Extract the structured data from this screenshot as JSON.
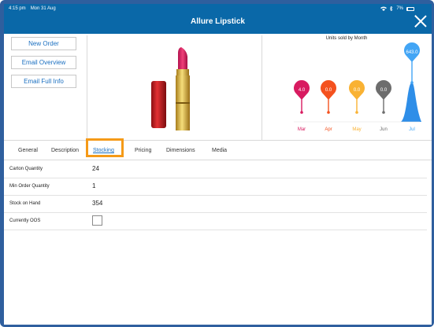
{
  "status": {
    "time": "4:15 pm",
    "date": "Mon 31 Aug",
    "battery": "7%"
  },
  "header": {
    "title": "Allure Lipstick"
  },
  "actions": [
    "New Order",
    "Email Overview",
    "Email Full Info"
  ],
  "chart_data": {
    "type": "line",
    "title": "Units sold by Month",
    "categories": [
      "Mar",
      "Apr",
      "May",
      "Jun",
      "Jul"
    ],
    "values": [
      4.0,
      0.0,
      0.0,
      0.0,
      643.0
    ],
    "labels": [
      "4.0",
      "0.0",
      "0.0",
      "0.0",
      "643.0"
    ],
    "colors": [
      "#d81b60",
      "#f4511e",
      "#f9b233",
      "#6d6d6d",
      "#42a5f5"
    ]
  },
  "tabs": [
    "General",
    "Description",
    "Stocking",
    "Pricing",
    "Dimensions",
    "Media"
  ],
  "active_tab": "Stocking",
  "fields": [
    {
      "label": "Carton Quantity",
      "value": "24"
    },
    {
      "label": "Min Order Quantity",
      "value": "1"
    },
    {
      "label": "Stock on Hand",
      "value": "354"
    },
    {
      "label": "Currently OOS",
      "value": ""
    }
  ]
}
